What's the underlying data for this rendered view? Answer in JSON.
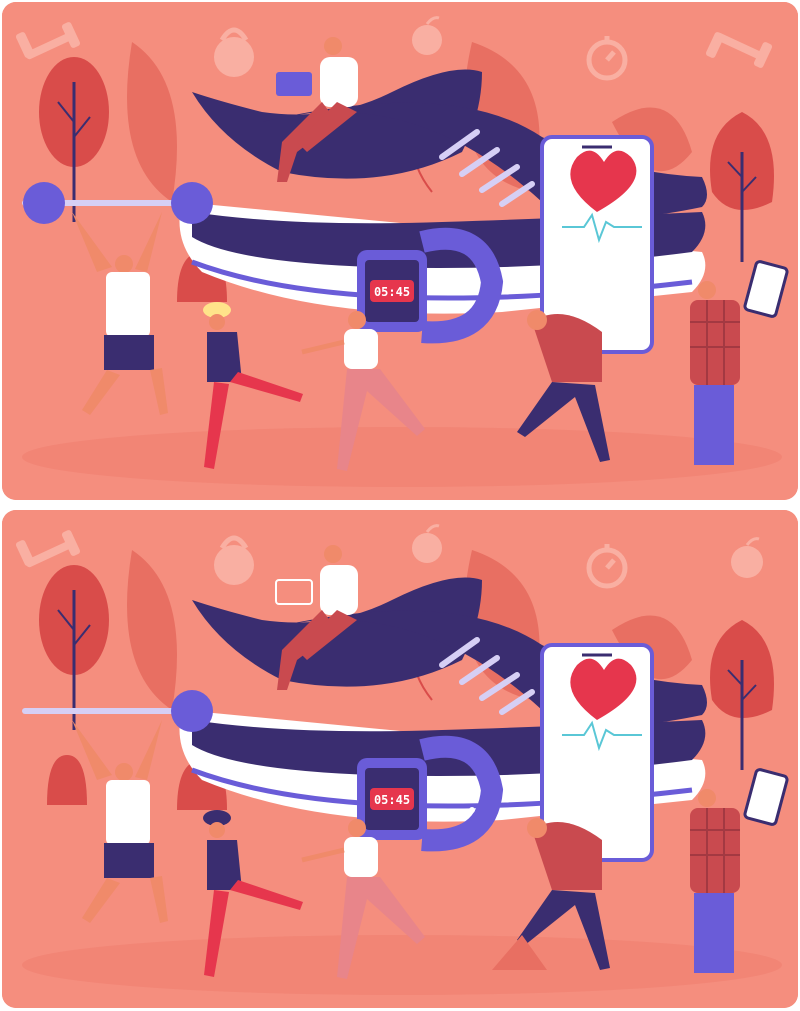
{
  "puzzle": {
    "panels": [
      {
        "id": "top",
        "watch_time": "05:45"
      },
      {
        "id": "bottom",
        "watch_time": "05:45"
      }
    ]
  },
  "colors": {
    "background": "#f58e7e",
    "shoe_upper": "#3a2d70",
    "shoe_sole": "#ffffff",
    "accent_purple": "#6a5cd8",
    "heart": "#e6364d",
    "leaf_dark": "#d94c4a",
    "leaf_light": "#f7a597"
  }
}
